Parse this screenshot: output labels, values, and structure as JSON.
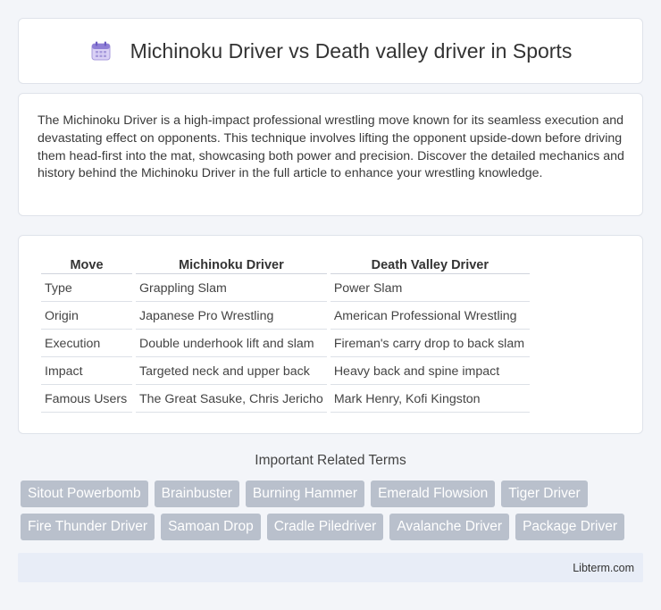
{
  "header": {
    "title": "Michinoku Driver vs Death valley driver in Sports",
    "icon": "calendar-icon"
  },
  "intro": {
    "text": "The Michinoku Driver is a high-impact professional wrestling move known for its seamless execution and devastating effect on opponents. This technique involves lifting the opponent upside-down before driving them head-first into the mat, showcasing both power and precision. Discover the detailed mechanics and history behind the Michinoku Driver in the full article to enhance your wrestling knowledge."
  },
  "table": {
    "headers": [
      "Move",
      "Michinoku Driver",
      "Death Valley Driver"
    ],
    "rows": [
      [
        "Type",
        "Grappling Slam",
        "Power Slam"
      ],
      [
        "Origin",
        "Japanese Pro Wrestling",
        "American Professional Wrestling"
      ],
      [
        "Execution",
        "Double underhook lift and slam",
        "Fireman's carry drop to back slam"
      ],
      [
        "Impact",
        "Targeted neck and upper back",
        "Heavy back and spine impact"
      ],
      [
        "Famous Users",
        "The Great Sasuke, Chris Jericho",
        "Mark Henry, Kofi Kingston"
      ]
    ]
  },
  "related": {
    "title": "Important Related Terms",
    "tags": [
      "Sitout Powerbomb",
      "Brainbuster",
      "Burning Hammer",
      "Emerald Flowsion",
      "Tiger Driver",
      "Fire Thunder Driver",
      "Samoan Drop",
      "Cradle Piledriver",
      "Avalanche Driver",
      "Package Driver"
    ]
  },
  "footer": {
    "brand": "Libterm.com"
  }
}
